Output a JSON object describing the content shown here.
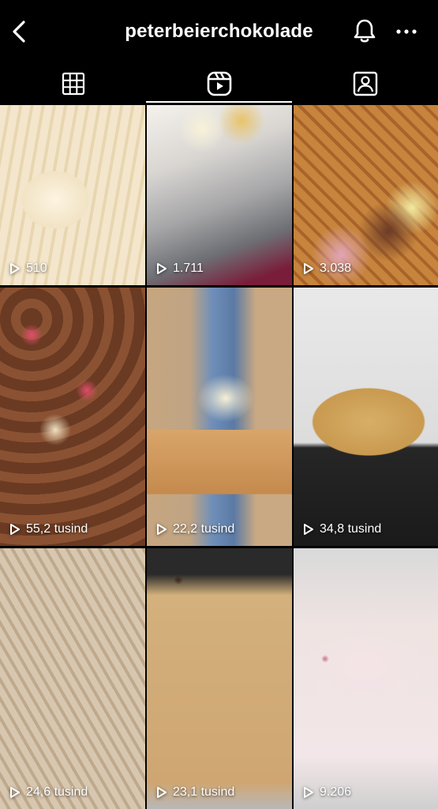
{
  "header": {
    "title": "peterbeierchokolade",
    "back_icon": "chevron-left-icon",
    "bell_icon": "bell-icon",
    "more_icon": "more-horizontal-icon"
  },
  "tabs": [
    {
      "name": "grid",
      "icon": "grid-icon",
      "active": false
    },
    {
      "name": "reels",
      "icon": "reels-icon",
      "active": true
    },
    {
      "name": "tagged",
      "icon": "tagged-icon",
      "active": false
    }
  ],
  "reels": [
    {
      "views": "510"
    },
    {
      "views": "1.711"
    },
    {
      "views": "3.038"
    },
    {
      "views": "55,2 tusind"
    },
    {
      "views": "22,2 tusind"
    },
    {
      "views": "34,8 tusind"
    },
    {
      "views": "24,6 tusind"
    },
    {
      "views": "23,1 tusind"
    },
    {
      "views": "9.206"
    }
  ],
  "colors": {
    "background": "#000000",
    "text": "#ffffff"
  }
}
